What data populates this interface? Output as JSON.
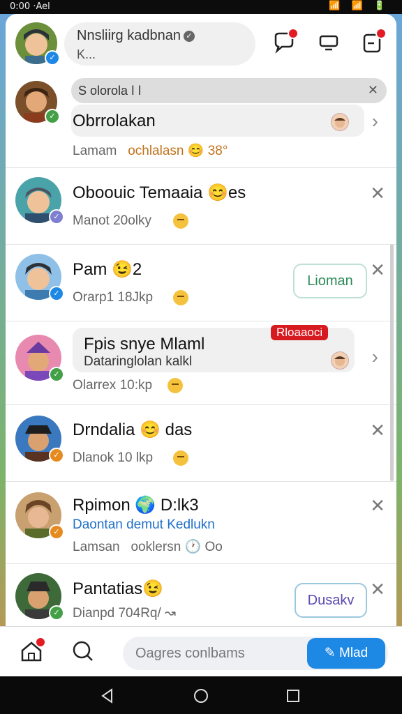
{
  "status_bar": {
    "time": "0:00 ·Ael",
    "icons": "📶 📶 🔋"
  },
  "header": {
    "name": "Nnsliirg kadbnan",
    "subtitle": "K..."
  },
  "header_icons": [
    "chat-bubble-icon",
    "screen-share-icon",
    "notification-icon"
  ],
  "search": {
    "value": "S olorola ǀ ǀ",
    "clear": "✕"
  },
  "conversations": [
    {
      "name": "Obrrolakan",
      "meta_left": "Lamam",
      "meta_right": "ochlalasn 😊 38°",
      "action": "chevron"
    },
    {
      "name": "Oboouic Temaaia 😊es",
      "meta": "Manot 20olky",
      "action": "close"
    },
    {
      "name": "Pam 😉2",
      "meta": "Orarp1 18Jkp",
      "action": "close",
      "button": "Lioman"
    },
    {
      "name": "Fpis snye Mlaml",
      "subline": "Dataringlolan kalkl",
      "meta": "Olarrex 10:kp",
      "tag": "Rloaaoci",
      "action": "chevron"
    },
    {
      "name": "Drndalia 😊 das",
      "meta": "Dlanok 10 lkp",
      "action": "close"
    },
    {
      "name": "Rpimon 🌍 D:lk3",
      "subline": "Daontan demut Kedlukn",
      "meta_left": "Lamsan",
      "meta_right": "ooklersn 🕐 Oo",
      "action": "close"
    },
    {
      "name": "Pantatias😉",
      "meta": "Dianpd 704Rq/ ↝",
      "action": "close",
      "button": "Dusakv"
    }
  ],
  "bottom": {
    "input_placeholder": "Oagres conlbams",
    "send_label": "Mlad"
  },
  "colors": {
    "accent_blue": "#1e88e5",
    "badge_green": "#43a047",
    "notif_red": "#e31b23"
  }
}
